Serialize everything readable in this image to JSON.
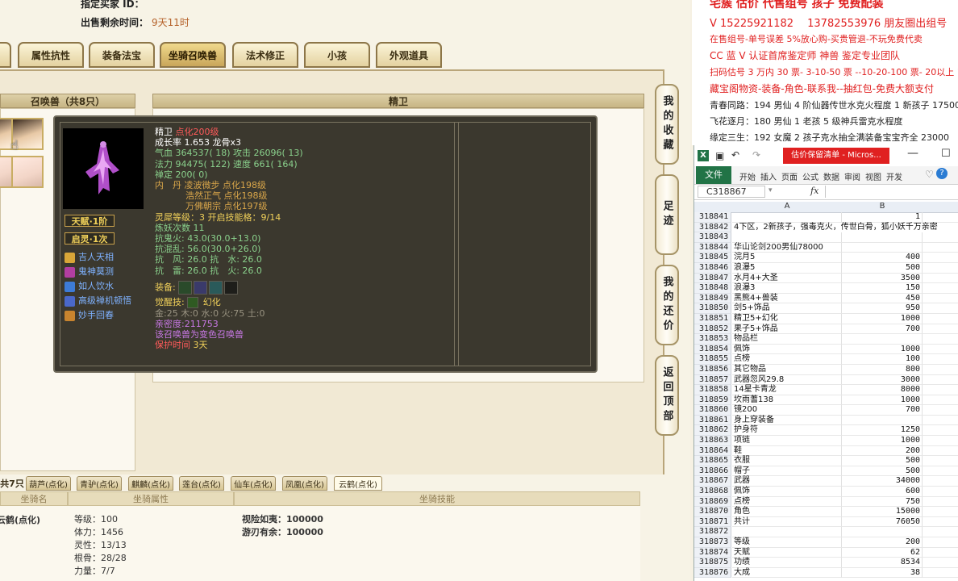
{
  "seller": {
    "top_label": "指定买家 ID：",
    "remain_label": "出售剩余时间：",
    "remain_value": "9天11时"
  },
  "tabs": [
    "属性抗性",
    "装备法宝",
    "坐骑召唤兽",
    "法术修正",
    "小孩",
    "外观道具"
  ],
  "active_tab": "坐骑召唤兽",
  "left_panel": {
    "title": "召唤兽（共8只）"
  },
  "right_panel": {
    "title": "精卫"
  },
  "pet": {
    "name": "精卫",
    "dianhua": "点化200级",
    "line_growth": "成长率 1.653 龙骨x3",
    "line_hp_atk": "气血 364537( 18) 攻击 26096( 13)",
    "line_mp_spd": "法力 94475( 122) 速度 661( 164)",
    "line_zen": "禅定 200( 0)",
    "neidan": [
      "内　丹 凌波微步 点化198级",
      "浩然正气 点化198级",
      "万佛朝宗 点化197级"
    ],
    "line_lingxi": "灵犀等级：3 开启技能格：9/14",
    "line_lianyao": "炼妖次数 11",
    "line_kanghuo": "抗鬼火: 43.0(30.0+13.0)",
    "line_kanghun": "抗混乱: 56.0(30.0+26.0)",
    "line_kang1": "抗　风: 26.0 抗　水: 26.0",
    "line_kang2": "抗　雷: 26.0 抗　火: 26.0",
    "equip_label": "装备:",
    "awaken_label": "觉醒技:",
    "awaken_value": "幻化",
    "line_elements": "金:25 木:0 水:0 火:75 土:0",
    "line_intimacy": "亲密度:211753",
    "line_variant": "该召唤兽为变色召唤兽",
    "protect_label": "保护时间",
    "protect_value": "3天",
    "talent": "天赋·1阶",
    "qiling": "启灵·1次",
    "skills": [
      "吉人天相",
      "鬼神莫测",
      "如人饮水",
      "高级禅机顿悟",
      "妙手回春"
    ]
  },
  "side_buttons": [
    "我的收藏",
    "足迹",
    "我的还价",
    "返回顶部"
  ],
  "mounts": {
    "count_label": "共7只",
    "tabs": [
      "葫芦(点化)",
      "青驴(点化)",
      "麒麟(点化)",
      "莲台(点化)",
      "仙车(点化)",
      "凤凰(点化)",
      "云鹤(点化)"
    ],
    "active_tab": "云鹤(点化)",
    "headers": [
      "坐骑名",
      "坐骑属性",
      "坐骑技能"
    ],
    "name": "云鹤(点化)",
    "attrs": [
      "等级：100",
      "体力：1456",
      "灵性：13/13",
      "根骨：28/28",
      "力量：7/7"
    ],
    "skills": [
      "视险如夷：100000",
      "游刃有余：100000"
    ]
  },
  "promo": {
    "lines": [
      "宅簇 估价 代售组号 孩子 免费配装",
      "V 15225921182　 13782553976 朋友圈出组号",
      "在售组号-单号误差 5%放心购-买贵管退-不玩免费代卖",
      "CC 蓝 V 认证首席鉴定师 神兽 鉴定专业团队",
      "扫码估号 3 万内 30 票- 3-10-50 票 --10-20-100 票- 20以上 150",
      "藏宝阁物资-装备-角色-联系我--抽红包-免费大额支付",
      "青春同路：194 男仙 4 阶仙器传世水克火程度 1 新孩子 17500",
      "飞花逐月：180 男仙 1 老孩 5 级神兵雷克水程度",
      "缘定三生：192 女魔 2 孩子克水抽全满装备宝宝齐全 23000"
    ]
  },
  "excel": {
    "title": "估价保留清单 - Micros...",
    "ribbon_tabs": [
      "文件",
      "开始",
      "插入",
      "页面",
      "公式",
      "数据",
      "审阅",
      "视图",
      "开发"
    ],
    "name_box": "C318867",
    "fx": "fx",
    "col_headers": [
      "A",
      "B"
    ],
    "rows": [
      {
        "n": "318841",
        "a": "",
        "b": "1"
      },
      {
        "n": "318842",
        "a": "4下区，2新孩子，强毒克火，传世白骨，狐小妖千万亲密",
        "b": ""
      },
      {
        "n": "318843",
        "a": "",
        "b": ""
      },
      {
        "n": "318844",
        "a": "华山论剑200男仙78000",
        "b": ""
      },
      {
        "n": "318845",
        "a": "浣月5",
        "b": "400"
      },
      {
        "n": "318846",
        "a": "浪瀑5",
        "b": "500"
      },
      {
        "n": "318847",
        "a": "水月4+大圣",
        "b": "3500"
      },
      {
        "n": "318848",
        "a": "浪瀑3",
        "b": "150"
      },
      {
        "n": "318849",
        "a": "黑熊4+兽装",
        "b": "450"
      },
      {
        "n": "318850",
        "a": "剑5+饰品",
        "b": "950"
      },
      {
        "n": "318851",
        "a": "精卫5+幻化",
        "b": "1000"
      },
      {
        "n": "318852",
        "a": "果子5+饰品",
        "b": "700"
      },
      {
        "n": "318853",
        "a": "物品栏",
        "b": ""
      },
      {
        "n": "318854",
        "a": "佩饰",
        "b": "1000"
      },
      {
        "n": "318855",
        "a": "点榜",
        "b": "100"
      },
      {
        "n": "318856",
        "a": "其它物品",
        "b": "800"
      },
      {
        "n": "318857",
        "a": "武器忽风29.8",
        "b": "3000"
      },
      {
        "n": "318858",
        "a": "14星卡青龙",
        "b": "8000"
      },
      {
        "n": "318859",
        "a": "坎雨蓍138",
        "b": "1000"
      },
      {
        "n": "318860",
        "a": "镜200",
        "b": "700"
      },
      {
        "n": "318861",
        "a": "身上穿装备",
        "b": ""
      },
      {
        "n": "318862",
        "a": "护身符",
        "b": "1250"
      },
      {
        "n": "318863",
        "a": "项链",
        "b": "1000"
      },
      {
        "n": "318864",
        "a": "鞋",
        "b": "200"
      },
      {
        "n": "318865",
        "a": "衣服",
        "b": "500"
      },
      {
        "n": "318866",
        "a": "帽子",
        "b": "500"
      },
      {
        "n": "318867",
        "a": "武器",
        "b": "34000"
      },
      {
        "n": "318868",
        "a": "佩饰",
        "b": "600"
      },
      {
        "n": "318869",
        "a": "点榜",
        "b": "750"
      },
      {
        "n": "318870",
        "a": "角色",
        "b": "15000"
      },
      {
        "n": "318871",
        "a": "共计",
        "b": "76050"
      },
      {
        "n": "318872",
        "a": "",
        "b": ""
      },
      {
        "n": "318873",
        "a": "等级",
        "b": "200"
      },
      {
        "n": "318874",
        "a": "天赋",
        "b": "62"
      },
      {
        "n": "318875",
        "a": "功绩",
        "b": "8534"
      },
      {
        "n": "318876",
        "a": "大成",
        "b": "38"
      }
    ]
  },
  "colors": {
    "tooltip_bg": "#3b382e",
    "stat_green": "#8ad18c",
    "accent_red": "#e02020",
    "excel_green": "#217346"
  }
}
